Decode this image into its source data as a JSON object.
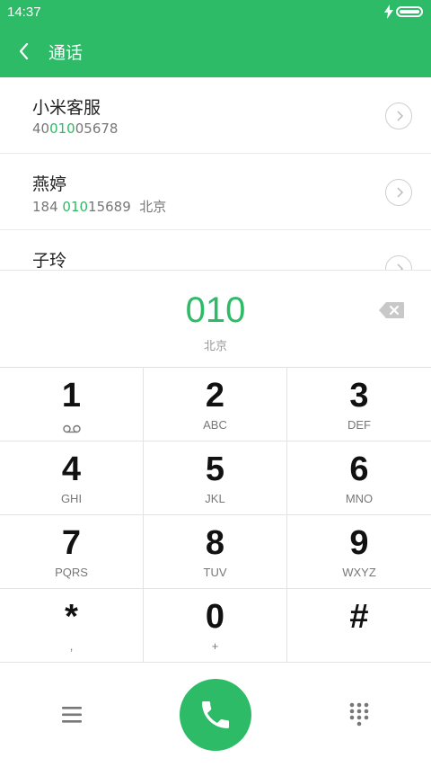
{
  "status": {
    "time": "14:37",
    "battery_level": 1.0
  },
  "header": {
    "title": "通话"
  },
  "results": [
    {
      "name": "小米客服",
      "number_pre": "40",
      "number_match": "010",
      "number_post": "05678",
      "location": ""
    },
    {
      "name": "燕婷",
      "number_pre": "184 ",
      "number_match": "010",
      "number_post": "15689",
      "location": "  北京"
    },
    {
      "name": "子玲",
      "number_pre": "",
      "number_match": "",
      "number_post": "",
      "location": ""
    }
  ],
  "dialer": {
    "number": "010",
    "location": "北京"
  },
  "keys": [
    {
      "digit": "1",
      "letters": ""
    },
    {
      "digit": "2",
      "letters": "ABC"
    },
    {
      "digit": "3",
      "letters": "DEF"
    },
    {
      "digit": "4",
      "letters": "GHI"
    },
    {
      "digit": "5",
      "letters": "JKL"
    },
    {
      "digit": "6",
      "letters": "MNO"
    },
    {
      "digit": "7",
      "letters": "PQRS"
    },
    {
      "digit": "8",
      "letters": "TUV"
    },
    {
      "digit": "9",
      "letters": "WXYZ"
    },
    {
      "digit": "*",
      "letters": ","
    },
    {
      "digit": "0",
      "letters": "+"
    },
    {
      "digit": "#",
      "letters": ""
    }
  ],
  "icons": {
    "back": "back-arrow-icon",
    "delete": "backspace-icon",
    "voicemail": "voicemail-icon",
    "menu": "menu-icon",
    "call": "phone-icon",
    "keypad": "keypad-icon",
    "chevron": "chevron-right-icon"
  },
  "colors": {
    "accent": "#2dbb67",
    "text": "#222222",
    "secondary": "#777777"
  }
}
